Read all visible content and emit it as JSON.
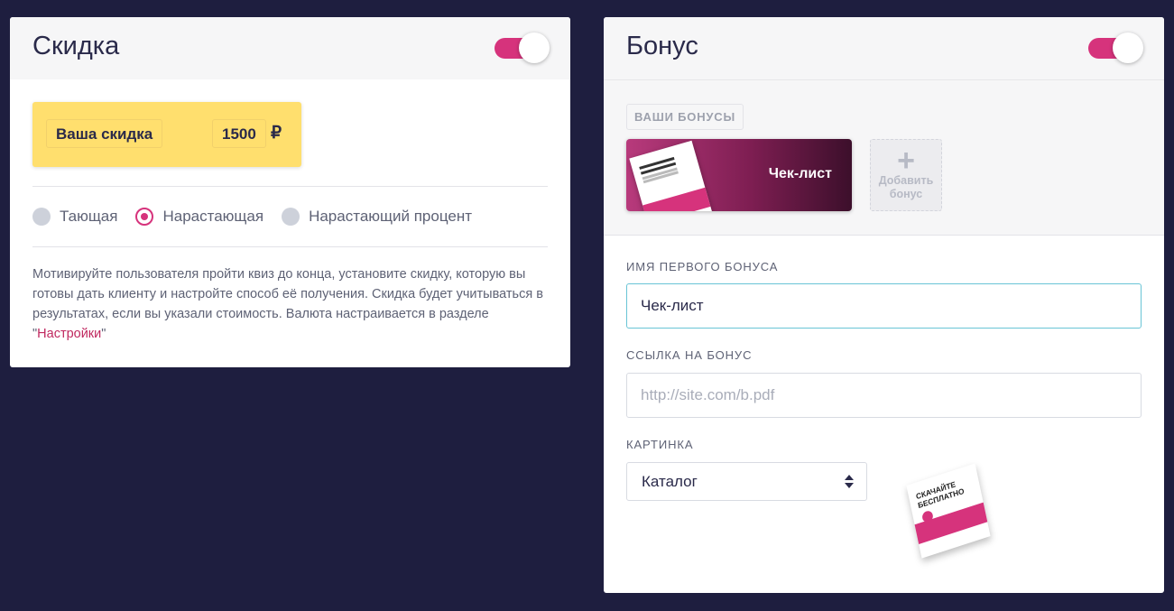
{
  "discount": {
    "title": "Скидка",
    "enabled": true,
    "label": "Ваша скидка",
    "value": "1500",
    "currency": "₽",
    "modes": [
      {
        "label": "Тающая",
        "selected": false
      },
      {
        "label": "Нарастающая",
        "selected": true
      },
      {
        "label": "Нарастающий процент",
        "selected": false
      }
    ],
    "help_text_before": "Мотивируйте пользователя пройти квиз до конца, установите скидку, которую вы готовы дать клиенту и настройте способ её получения. Скидка будет учитываться в результатах, если вы указали стоимость. Валюта настраивается в разделе \"",
    "help_link": "Настройки",
    "help_text_after": "\""
  },
  "bonus": {
    "title": "Бонус",
    "enabled": true,
    "section_tag": "ВАШИ БОНУСЫ",
    "items": [
      {
        "title": "Чек-лист"
      }
    ],
    "add_plus": "+",
    "add_label": "Добавить бонус",
    "name_label": "ИМЯ ПЕРВОГО БОНУСА",
    "name_value": "Чек-лист",
    "link_label": "ССЫЛКА НА БОНУС",
    "link_placeholder": "http://site.com/b.pdf",
    "image_label": "КАРТИНКА",
    "image_select_value": "Каталог",
    "preview_title": "СКАЧАЙТЕ БЕСПЛАТНО"
  },
  "colors": {
    "background": "#1e1e3f",
    "accent": "#d6337c",
    "discount_box": "#ffdf6e",
    "focus_border": "#69c4d6"
  }
}
